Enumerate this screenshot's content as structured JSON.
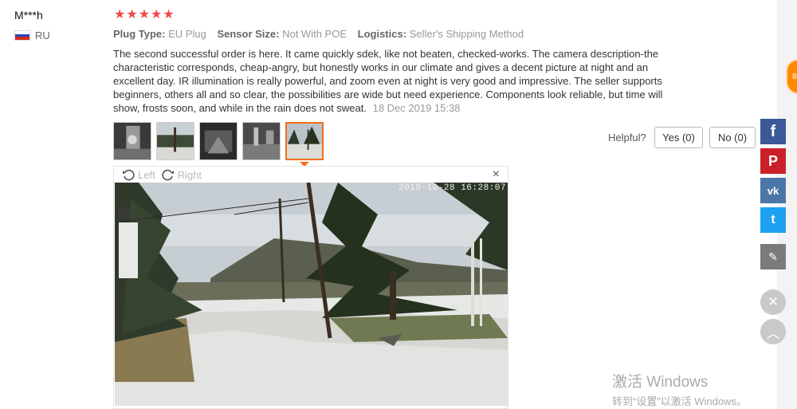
{
  "reviewer": {
    "name": "M***h",
    "country": "RU"
  },
  "rating": {
    "stars": 5,
    "max": 5
  },
  "attributes": [
    {
      "key": "Plug Type:",
      "value": "EU Plug"
    },
    {
      "key": "Sensor Size:",
      "value": "Not With POE"
    },
    {
      "key": "Logistics:",
      "value": "Seller's Shipping Method"
    }
  ],
  "review": {
    "text": "The second successful order is here. It came quickly sdek, like not beaten, checked-works. The camera description-the characteristic corresponds, cheap-angry, but honestly works in our climate and gives a decent picture at night and an excellent day. IR illumination is really powerful, and zoom even at night is very good and impressive. The seller supports beginners, others all and so clear, the possibilities are wide but need experience. Components look reliable, but time will show, frosts soon, and while in the rain does not sweat.",
    "date": "18 Dec 2019 15:38"
  },
  "helpful": {
    "label": "Helpful?",
    "yes": "Yes (0)",
    "no": "No (0)"
  },
  "viewer": {
    "rotate_left": "Left",
    "rotate_right": "Right",
    "close": "×",
    "timestamp": "2019-10-28 16:28:07"
  },
  "share": {
    "facebook": "f",
    "pinterest": "P",
    "vk": "vk",
    "twitter": "t",
    "edit": "✎"
  },
  "badge": "8",
  "watermark": {
    "line1": "激活 Windows",
    "line2": "转到“设置”以激活 Windows。"
  },
  "colors": {
    "star": "#f04848",
    "active_thumb": "#f07020",
    "facebook": "#3b5998",
    "pinterest": "#cb2027",
    "vk": "#4a76a8",
    "twitter": "#1da1f2"
  }
}
